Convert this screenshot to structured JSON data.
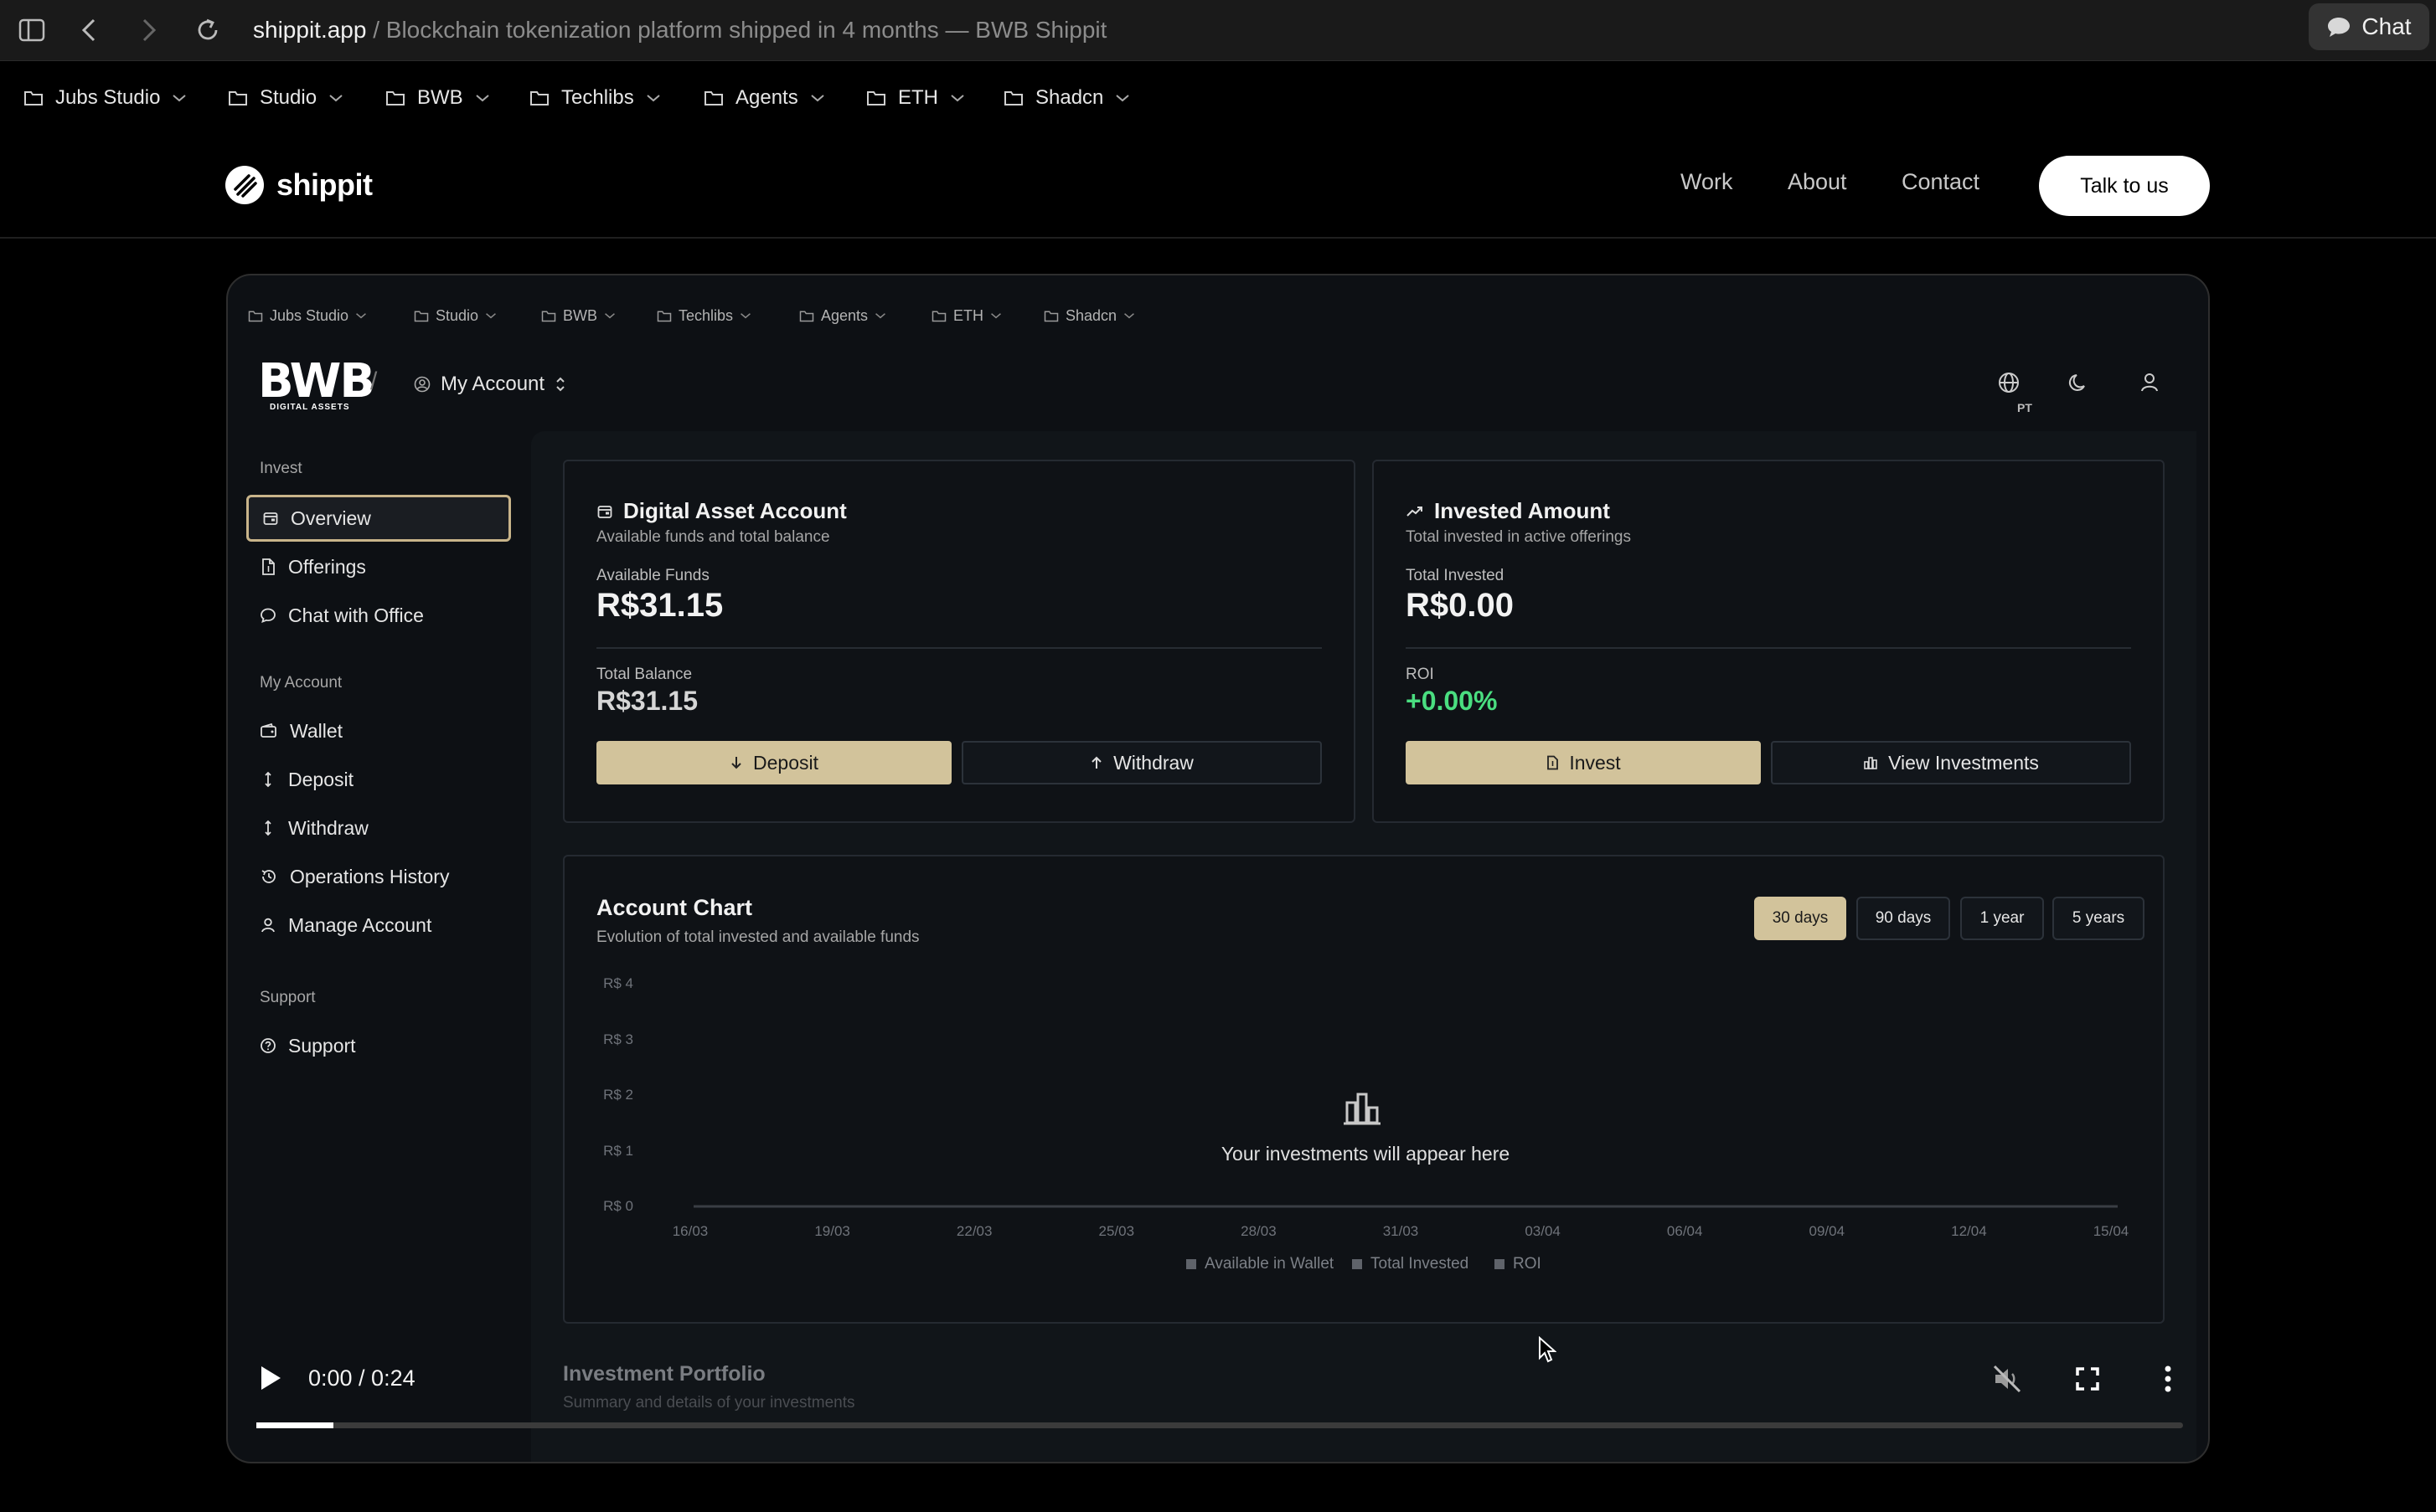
{
  "browser": {
    "url_host": "shippit.app",
    "url_rest": " / Blockchain tokenization platform shipped in 4 months — BWB Shippit",
    "chat_label": "Chat",
    "bookmarks": [
      "Jubs Studio",
      "Studio",
      "BWB",
      "Techlibs",
      "Agents",
      "ETH",
      "Shadcn"
    ]
  },
  "site": {
    "logo_text": "shippit",
    "nav": [
      "Work",
      "About",
      "Contact"
    ],
    "cta": "Talk to us"
  },
  "app": {
    "bookmarks": [
      "Jubs Studio",
      "Studio",
      "BWB",
      "Techlibs",
      "Agents",
      "ETH",
      "Shadcn"
    ],
    "logo_word": "BWB",
    "logo_sub": "DIGITAL ASSETS",
    "crumb_sep": "/",
    "account_label": "My Account",
    "lang_code": "PT",
    "sidebar": {
      "invest_title": "Invest",
      "invest_items": [
        "Overview",
        "Offerings",
        "Chat with Office"
      ],
      "account_title": "My Account",
      "account_items": [
        "Wallet",
        "Deposit",
        "Withdraw",
        "Operations History",
        "Manage Account"
      ],
      "support_title": "Support",
      "support_items": [
        "Support"
      ]
    },
    "digital_card": {
      "title": "Digital Asset Account",
      "subtitle": "Available funds and total balance",
      "available_label": "Available Funds",
      "available_value": "R$31.15",
      "total_label": "Total Balance",
      "total_value": "R$31.15",
      "deposit_label": "Deposit",
      "withdraw_label": "Withdraw"
    },
    "invested_card": {
      "title": "Invested Amount",
      "subtitle": "Total invested in active offerings",
      "total_label": "Total Invested",
      "total_value": "R$0.00",
      "roi_label": "ROI",
      "roi_value": "+0.00%",
      "invest_label": "Invest",
      "view_label": "View Investments"
    },
    "account_chart": {
      "title": "Account Chart",
      "subtitle": "Evolution of total invested and available funds",
      "ranges": [
        "30 days",
        "90 days",
        "1 year",
        "5 years"
      ],
      "active_range": "30 days",
      "empty_message": "Your investments will appear here"
    },
    "portfolio": {
      "title": "Investment Portfolio",
      "subtitle": "Summary and details of your investments"
    }
  },
  "chart_data": {
    "type": "line",
    "title": "Account Chart",
    "x": [
      "16/03",
      "19/03",
      "22/03",
      "25/03",
      "28/03",
      "31/03",
      "03/04",
      "06/04",
      "09/04",
      "12/04",
      "15/04"
    ],
    "y_ticks": [
      "R$ 4",
      "R$ 3",
      "R$ 2",
      "R$ 1",
      "R$ 0"
    ],
    "ylim": [
      0,
      4
    ],
    "series": [
      {
        "name": "Available in Wallet",
        "values": []
      },
      {
        "name": "Total Invested",
        "values": []
      },
      {
        "name": "ROI",
        "values": []
      }
    ],
    "legend": "bottom",
    "grid": false
  },
  "video": {
    "time": "0:00 / 0:24",
    "progress": 0.04,
    "colors": {
      "gold": "#d2c39b",
      "roi_green": "#4ade80"
    }
  }
}
